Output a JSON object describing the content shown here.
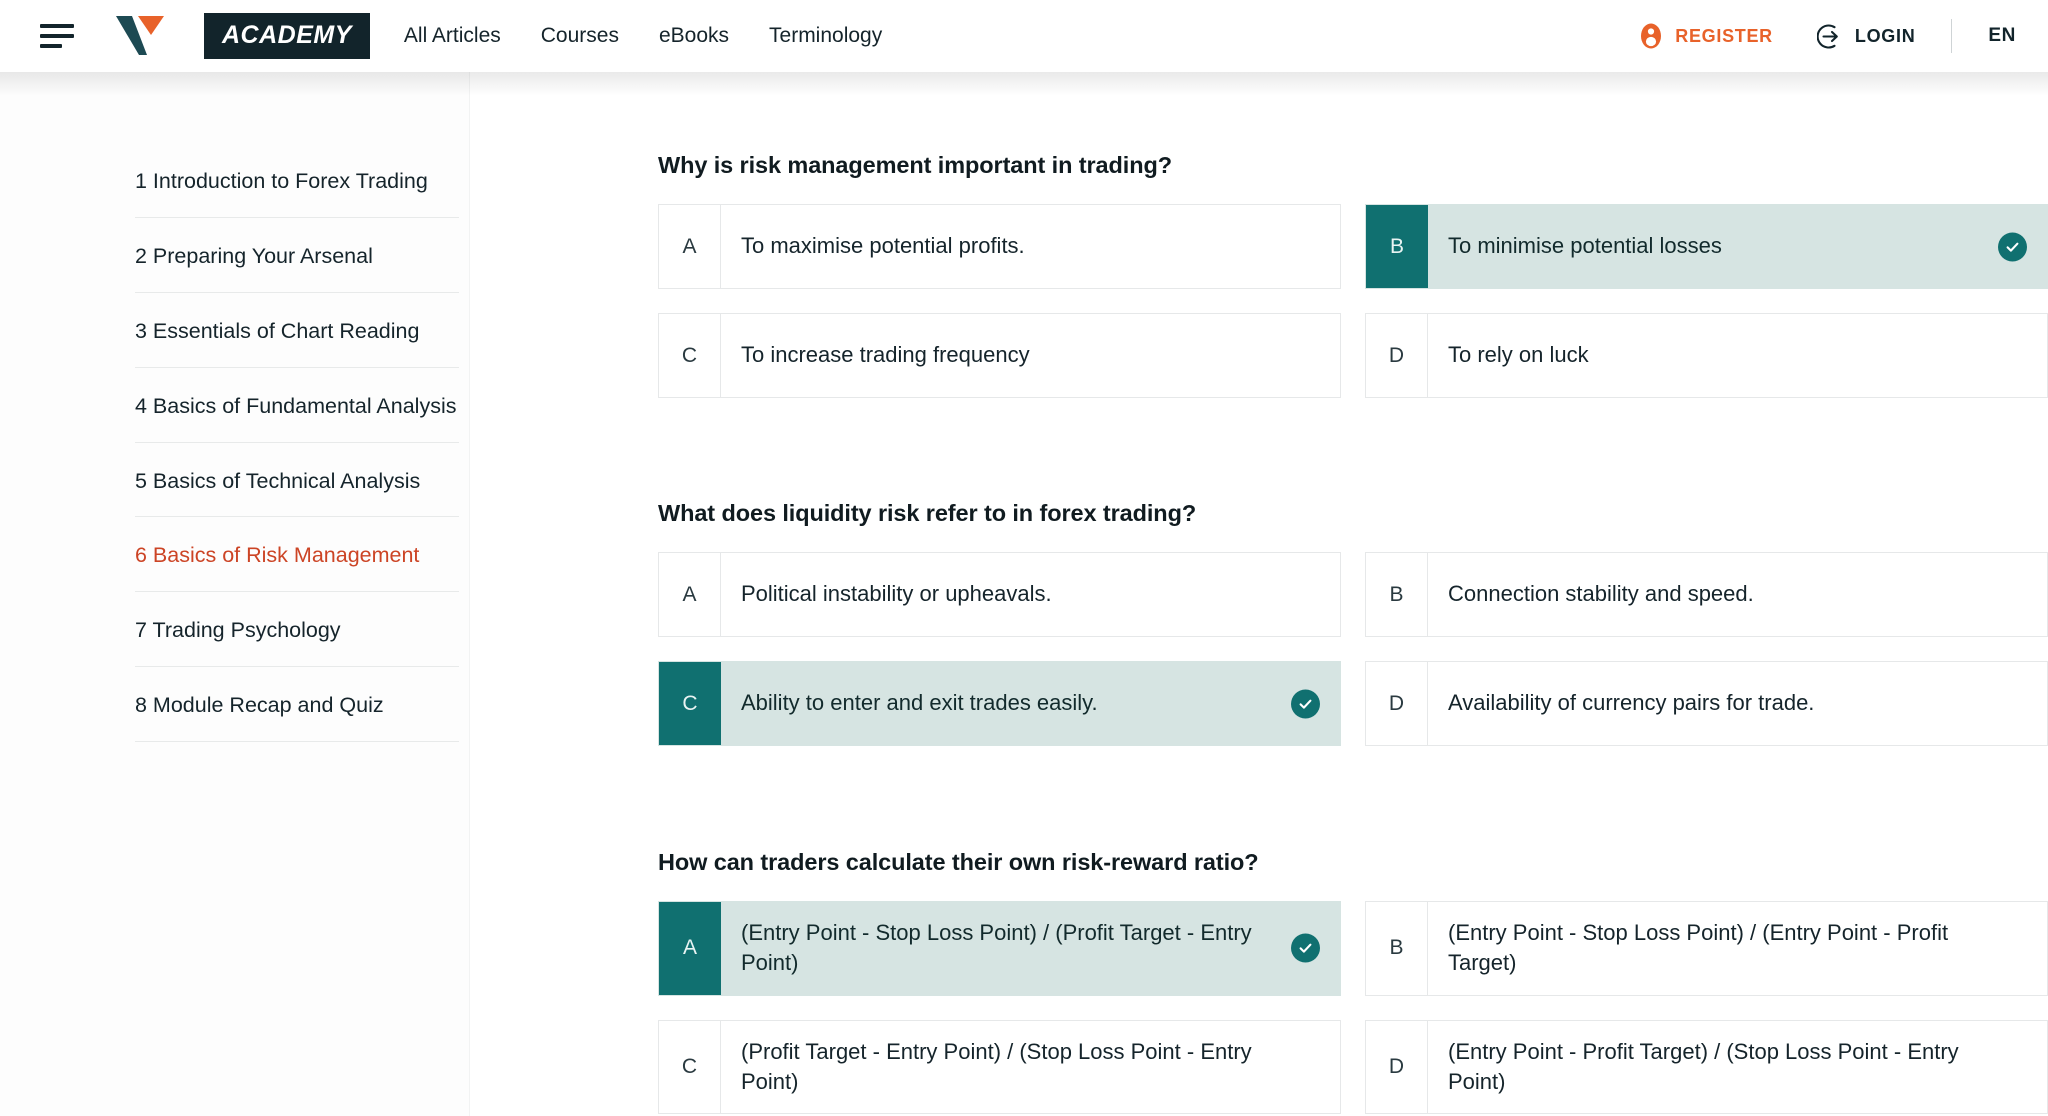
{
  "header": {
    "menu_icon": "hamburger-icon",
    "logo_icon": "vantage-v-logo",
    "badge_label": "ACADEMY",
    "nav": [
      {
        "label": "All Articles"
      },
      {
        "label": "Courses"
      },
      {
        "label": "eBooks"
      },
      {
        "label": "Terminology"
      }
    ],
    "register_label": "REGISTER",
    "register_icon": "user-circle-icon",
    "register_color": "#e8622a",
    "login_label": "LOGIN",
    "login_icon": "login-arrow-icon",
    "language_label": "EN"
  },
  "sidebar": {
    "items": [
      {
        "label": "1 Introduction to Forex Trading",
        "active": false
      },
      {
        "label": "2 Preparing Your Arsenal",
        "active": false
      },
      {
        "label": "3 Essentials of Chart Reading",
        "active": false
      },
      {
        "label": "4 Basics of Fundamental Analysis",
        "active": false
      },
      {
        "label": "5 Basics of Technical Analysis",
        "active": false
      },
      {
        "label": "6 Basics of Risk Management",
        "active": true
      },
      {
        "label": "7 Trading Psychology",
        "active": false
      },
      {
        "label": "8 Module Recap and Quiz",
        "active": false
      }
    ],
    "active_color": "#cc4425"
  },
  "quiz": {
    "clipped_text_above": "",
    "selected_color": "#107070",
    "selected_bg": "#d6e4e2",
    "check_icon": "check-circle-icon",
    "questions": [
      {
        "title": "Why is risk management important in trading?",
        "options": [
          {
            "letter": "A",
            "text": "To maximise potential profits.",
            "selected": false
          },
          {
            "letter": "B",
            "text": "To minimise potential losses",
            "selected": true
          },
          {
            "letter": "C",
            "text": "To increase trading frequency",
            "selected": false
          },
          {
            "letter": "D",
            "text": "To rely on luck",
            "selected": false
          }
        ]
      },
      {
        "title": "What does liquidity risk refer to in forex trading?",
        "options": [
          {
            "letter": "A",
            "text": "Political instability or upheavals.",
            "selected": false
          },
          {
            "letter": "B",
            "text": "Connection stability and speed.",
            "selected": false
          },
          {
            "letter": "C",
            "text": "Ability to enter and exit trades easily.",
            "selected": true
          },
          {
            "letter": "D",
            "text": "Availability of currency pairs for trade.",
            "selected": false
          }
        ]
      },
      {
        "title": "How can traders calculate their own risk-reward ratio?",
        "options": [
          {
            "letter": "A",
            "text": "(Entry Point - Stop Loss Point) / (Profit Target - Entry Point)",
            "selected": true
          },
          {
            "letter": "B",
            "text": "(Entry Point - Stop Loss Point) / (Entry Point - Profit Target)",
            "selected": false
          },
          {
            "letter": "C",
            "text": "(Profit Target - Entry Point) / (Stop Loss Point - Entry Point)",
            "selected": false
          },
          {
            "letter": "D",
            "text": "(Entry Point - Profit Target) / (Stop Loss Point - Entry Point)",
            "selected": false
          }
        ]
      }
    ]
  }
}
